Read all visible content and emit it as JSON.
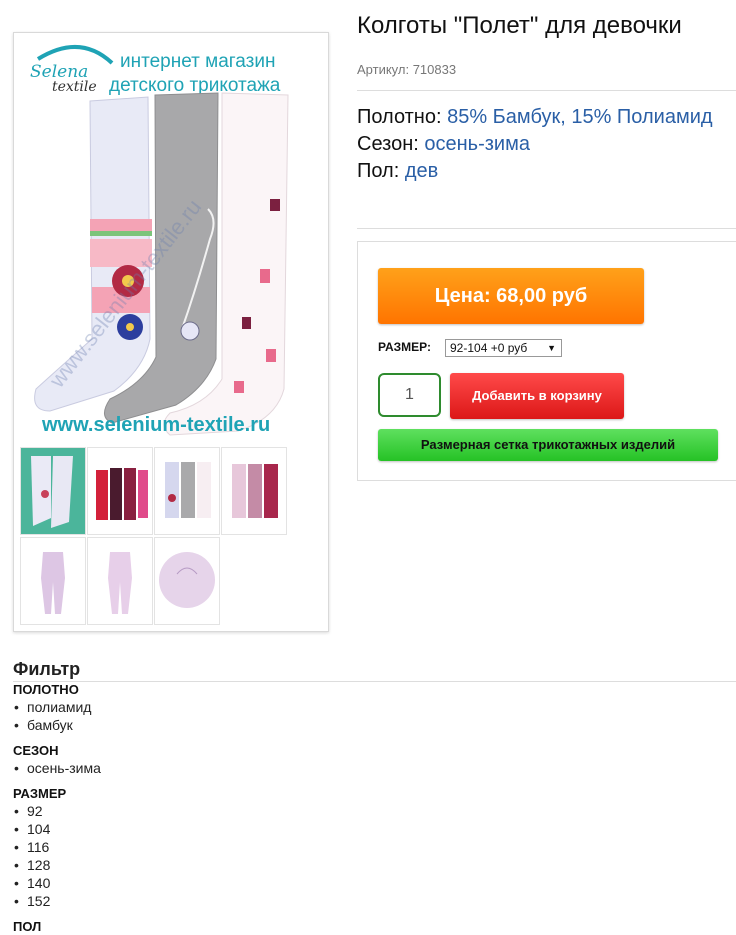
{
  "product": {
    "title": "Колготы \"Полет\" для девочки",
    "sku": "Артикул: 710833",
    "props": [
      {
        "label": "Полотно:",
        "value": "85% Бамбук, 15% Полиамид"
      },
      {
        "label": "Сезон:",
        "value": "осень-зима"
      },
      {
        "label": "Пол:",
        "value": "дев"
      }
    ]
  },
  "image": {
    "logo_line1": "Selena",
    "logo_line2": "textile",
    "shop_line1": "интернет магазин",
    "shop_line2": "детского трикотажа",
    "site": "www.selenium-textile.ru",
    "watermark": "www.selenium-textile.ru"
  },
  "buy": {
    "price_label": "Цена: 68,00 руб",
    "size_label": "РАЗМЕР:",
    "size_selected": "92-104 +0 руб",
    "qty": "1",
    "cart_label": "Добавить в корзину",
    "sizes_label": "Размерная сетка трикотажных изделий"
  },
  "filter": {
    "title": "Фильтр",
    "groups": [
      {
        "title": "ПОЛОТНО",
        "items": [
          "полиамид",
          "бамбук"
        ]
      },
      {
        "title": "СЕЗОН",
        "items": [
          "осень-зима"
        ]
      },
      {
        "title": "РАЗМЕР",
        "items": [
          "92",
          "104",
          "116",
          "128",
          "140",
          "152"
        ]
      },
      {
        "title": "ПОЛ",
        "items": []
      }
    ]
  },
  "colors": {
    "price": "#ff8a0d",
    "cart": "#ee2b2b",
    "sizes": "#3fd23f",
    "accent_text": "#2a5fa6",
    "logo_teal": "#1fa3b5"
  }
}
